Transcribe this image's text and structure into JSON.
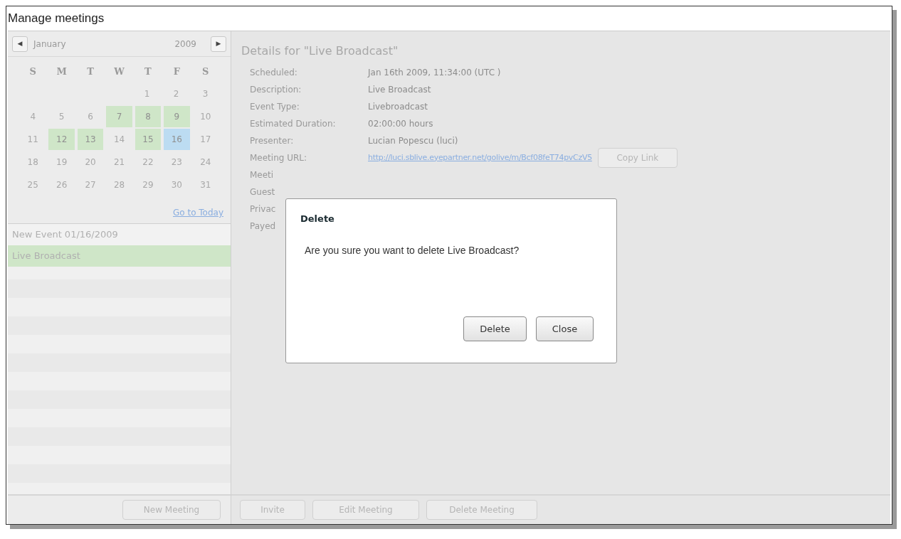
{
  "window": {
    "title": "Manage meetings"
  },
  "calendar": {
    "month": "January",
    "year": "2009",
    "prev": "◀",
    "next": "▶",
    "weekdays": [
      "S",
      "M",
      "T",
      "W",
      "T",
      "F",
      "S"
    ],
    "weeks": [
      [
        {
          "label": "1",
          "has_event": false,
          "selected": false
        },
        {
          "label": "2",
          "has_event": false,
          "selected": false
        },
        {
          "label": "3",
          "has_event": false,
          "selected": false
        }
      ],
      [
        {
          "label": "4",
          "has_event": false,
          "selected": false
        },
        {
          "label": "5",
          "has_event": false,
          "selected": false
        },
        {
          "label": "6",
          "has_event": false,
          "selected": false
        },
        {
          "label": "7",
          "has_event": true,
          "selected": false
        },
        {
          "label": "8",
          "has_event": true,
          "selected": false
        },
        {
          "label": "9",
          "has_event": true,
          "selected": false
        },
        {
          "label": "10",
          "has_event": false,
          "selected": false
        }
      ],
      [
        {
          "label": "11",
          "has_event": false,
          "selected": false
        },
        {
          "label": "12",
          "has_event": true,
          "selected": false
        },
        {
          "label": "13",
          "has_event": true,
          "selected": false
        },
        {
          "label": "14",
          "has_event": false,
          "selected": false
        },
        {
          "label": "15",
          "has_event": true,
          "selected": false
        },
        {
          "label": "16",
          "has_event": true,
          "selected": true
        },
        {
          "label": "17",
          "has_event": false,
          "selected": false
        }
      ],
      [
        {
          "label": "18",
          "has_event": false,
          "selected": false
        },
        {
          "label": "19",
          "has_event": false,
          "selected": false
        },
        {
          "label": "20",
          "has_event": false,
          "selected": false
        },
        {
          "label": "21",
          "has_event": false,
          "selected": false
        },
        {
          "label": "22",
          "has_event": false,
          "selected": false
        },
        {
          "label": "23",
          "has_event": false,
          "selected": false
        },
        {
          "label": "24",
          "has_event": false,
          "selected": false
        }
      ],
      [
        {
          "label": "25",
          "has_event": false,
          "selected": false
        },
        {
          "label": "26",
          "has_event": false,
          "selected": false
        },
        {
          "label": "27",
          "has_event": false,
          "selected": false
        },
        {
          "label": "28",
          "has_event": false,
          "selected": false
        },
        {
          "label": "29",
          "has_event": false,
          "selected": false
        },
        {
          "label": "30",
          "has_event": false,
          "selected": false
        },
        {
          "label": "31",
          "has_event": false,
          "selected": false
        }
      ]
    ],
    "go_to_today": "Go to Today"
  },
  "events": [
    {
      "label": "New Event 01/16/2009",
      "selected": false
    },
    {
      "label": "Live Broadcast",
      "selected": true
    }
  ],
  "details": {
    "title": "Details for \"Live Broadcast\"",
    "fields": [
      {
        "label": "Scheduled:",
        "value": "Jan 16th 2009, 11:34:00 (UTC )",
        "kind": "text"
      },
      {
        "label": "Description:",
        "value": "Live Broadcast",
        "kind": "text"
      },
      {
        "label": "Event Type:",
        "value": "Livebroadcast",
        "kind": "text"
      },
      {
        "label": "Estimated Duration:",
        "value": "02:00:00 hours",
        "kind": "text"
      },
      {
        "label": "Presenter:",
        "value": "Lucian Popescu (luci)",
        "kind": "text"
      },
      {
        "label": "Meeting URL:",
        "value": "http://luci.sblive.eyepartner.net/golive/m/Bcf08feT74pvCzV5",
        "kind": "link",
        "button": "Copy Link"
      },
      {
        "label": "Meeti",
        "kind": "covered"
      },
      {
        "label": "Guest",
        "kind": "covered"
      },
      {
        "label": "Privac",
        "kind": "covered"
      },
      {
        "label": "Payed",
        "kind": "covered"
      }
    ]
  },
  "left_buttons": [
    "New Meeting"
  ],
  "buttons": [
    "Invite",
    "Edit Meeting",
    "Delete Meeting"
  ],
  "dialog": {
    "title": "Delete",
    "message": "Are you sure you want to delete Live Broadcast?",
    "buttons": [
      "Delete",
      "Close"
    ]
  }
}
